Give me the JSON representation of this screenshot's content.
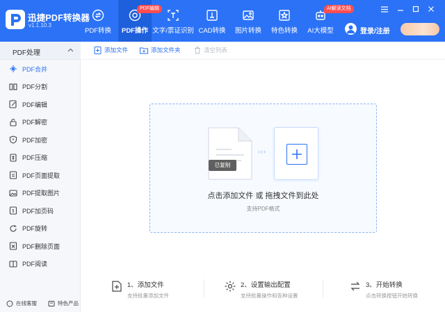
{
  "app": {
    "name": "迅捷PDF转换器",
    "version": "v1.1.10.3"
  },
  "nav": [
    {
      "label": "PDF转换",
      "icon": "convert-icon"
    },
    {
      "label": "PDF操作",
      "icon": "gear-icon",
      "active": true,
      "badge": "PDF编辑"
    },
    {
      "label": "文字/票证识别",
      "icon": "scan-text-icon"
    },
    {
      "label": "CAD转换",
      "icon": "cad-icon"
    },
    {
      "label": "图片转换",
      "icon": "image-icon"
    },
    {
      "label": "特色转换",
      "icon": "special-convert-icon"
    },
    {
      "label": "AI大模型",
      "icon": "ai-robot-icon",
      "badge": "AI解读文档"
    }
  ],
  "user": {
    "login_label": "登录/注册"
  },
  "sidebar": {
    "header": "PDF处理",
    "items": [
      {
        "label": "PDF合并",
        "icon": "merge-icon",
        "active": true
      },
      {
        "label": "PDF分割",
        "icon": "split-icon"
      },
      {
        "label": "PDF编辑",
        "icon": "edit-icon"
      },
      {
        "label": "PDF解密",
        "icon": "unlock-icon"
      },
      {
        "label": "PDF加密",
        "icon": "shield-icon"
      },
      {
        "label": "PDF压缩",
        "icon": "compress-icon"
      },
      {
        "label": "PDF页面提取",
        "icon": "page-extract-icon"
      },
      {
        "label": "PDF提取图片",
        "icon": "image-extract-icon"
      },
      {
        "label": "PDF加页码",
        "icon": "page-number-icon"
      },
      {
        "label": "PDF旋转",
        "icon": "rotate-icon"
      },
      {
        "label": "PDF删除页面",
        "icon": "delete-page-icon"
      },
      {
        "label": "PDF阅读",
        "icon": "book-icon"
      }
    ],
    "footer": {
      "service": "在线客服",
      "products": "特色产品"
    }
  },
  "toolbar": {
    "add_file": "添加文件",
    "add_folder": "添加文件夹",
    "clear_list": "清空列表"
  },
  "dropzone": {
    "tag": "已复制",
    "main_text": "点击添加文件 或 拖拽文件到此处",
    "sub_text": "支持PDF格式"
  },
  "steps": [
    {
      "title": "1、添加文件",
      "desc": "支持批量添加文件"
    },
    {
      "title": "2、设置输出配置",
      "desc": "支持批量操作和各种设置"
    },
    {
      "title": "3、开始转换",
      "desc": "点击转换按钮开始转换"
    }
  ],
  "colors": {
    "brand": "#2b72f6",
    "brand_dark": "#1e5fdc",
    "badge_red": "#ff4d4f"
  }
}
